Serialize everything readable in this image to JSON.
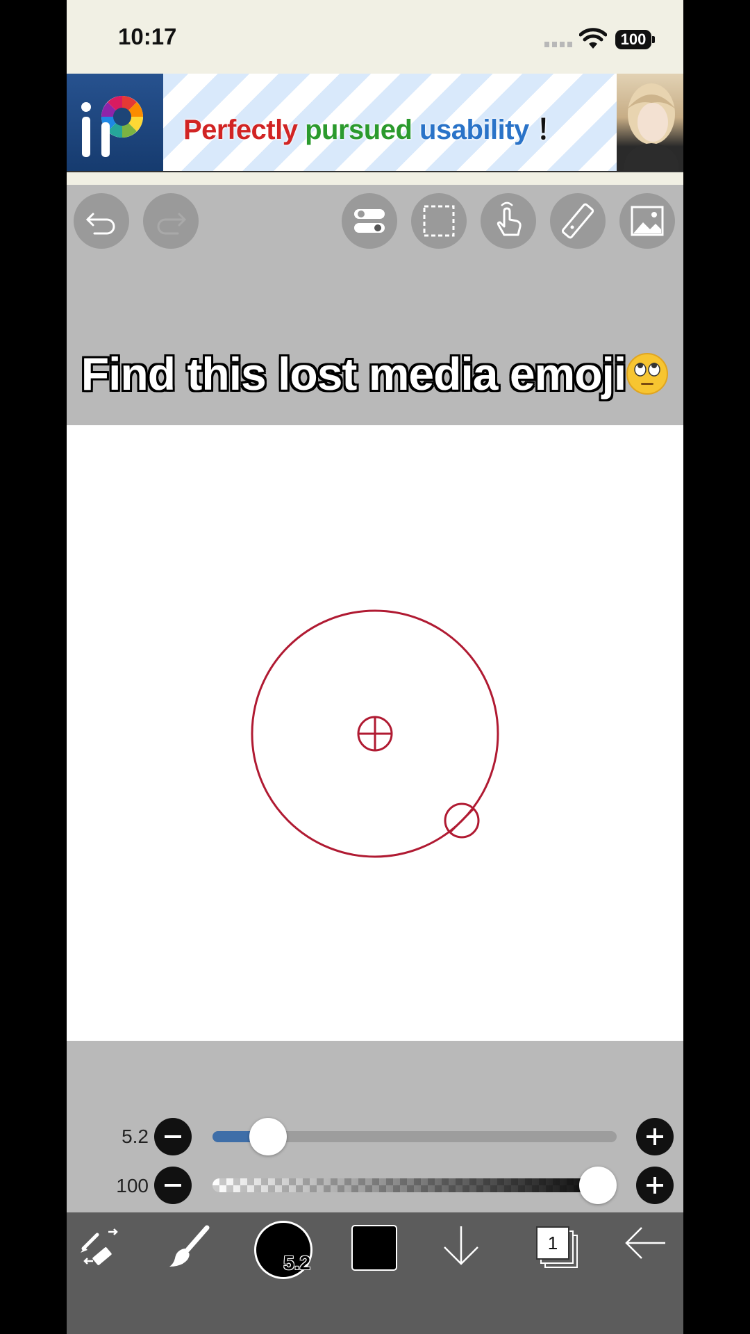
{
  "status_bar": {
    "time": "10:17",
    "battery": "100"
  },
  "ad_banner": {
    "logo_letter": "iP",
    "headline_words": [
      "Perfectly",
      "pursued",
      "usability",
      "！"
    ]
  },
  "toolbar": {
    "left_buttons": [
      "undo-icon",
      "redo-icon"
    ],
    "right_buttons": [
      "toggle-icon",
      "selection-icon",
      "hand-icon",
      "ruler-icon",
      "image-icon"
    ]
  },
  "overlay_caption": "Find this lost media emoji",
  "canvas": {
    "stroke_color": "#b01a32"
  },
  "brush_panel": {
    "size_value": "5.2",
    "size_fraction": 0.1,
    "opacity_value": "100",
    "opacity_fraction": 1.0
  },
  "bottom_bar": {
    "brush_size_label": "5.2",
    "color": "#000000",
    "layer_count": "1"
  }
}
